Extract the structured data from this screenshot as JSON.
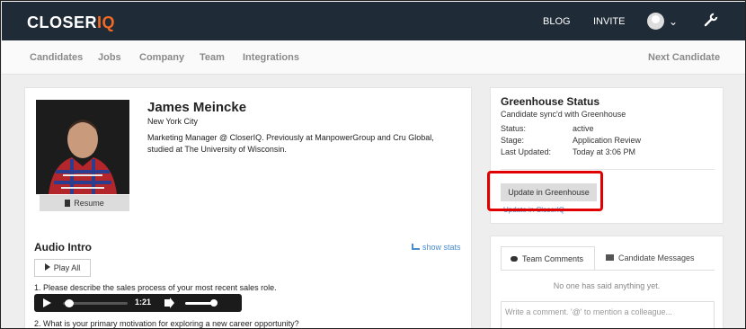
{
  "brand": {
    "logo_main": "CLOSER",
    "logo_accent": "IQ",
    "accent_color": "#f26a23",
    "topbar_color": "#1f2b36"
  },
  "topnav": {
    "blog": "BLOG",
    "invite": "INVITE"
  },
  "subnav": {
    "tabs": [
      "Candidates",
      "Jobs",
      "Company",
      "Team",
      "Integrations"
    ],
    "next": "Next Candidate"
  },
  "profile": {
    "name": "James Meincke",
    "location": "New York City",
    "bio": "Marketing Manager @ CloserIQ. Previously at ManpowerGroup and Cru Global, studied at The University of Wisconsin.",
    "resume_label": "Resume"
  },
  "audio": {
    "title": "Audio Intro",
    "show_stats": "show stats",
    "play_all": "Play All",
    "questions": [
      "1. Please describe the sales process of your most recent sales role.",
      "2. What is your primary motivation for exploring a new career opportunity?"
    ],
    "player_time": "1:21",
    "player_progress": 0.1,
    "volume_level": 0.9
  },
  "greenhouse": {
    "title": "Greenhouse Status",
    "subtitle": "Candidate sync'd with Greenhouse",
    "rows": [
      {
        "label": "Status:",
        "value": "active"
      },
      {
        "label": "Stage:",
        "value": "Application Review"
      },
      {
        "label": "Last Updated:",
        "value": "Today at 3:06 PM"
      }
    ],
    "update_button": "Update in Greenhouse",
    "link": "Update in CloserIQ"
  },
  "comments": {
    "tab_team": "Team Comments",
    "tab_candidate": "Candidate Messages",
    "empty": "No one has said anything yet.",
    "placeholder": "Write a comment. '@' to mention a colleague..."
  }
}
